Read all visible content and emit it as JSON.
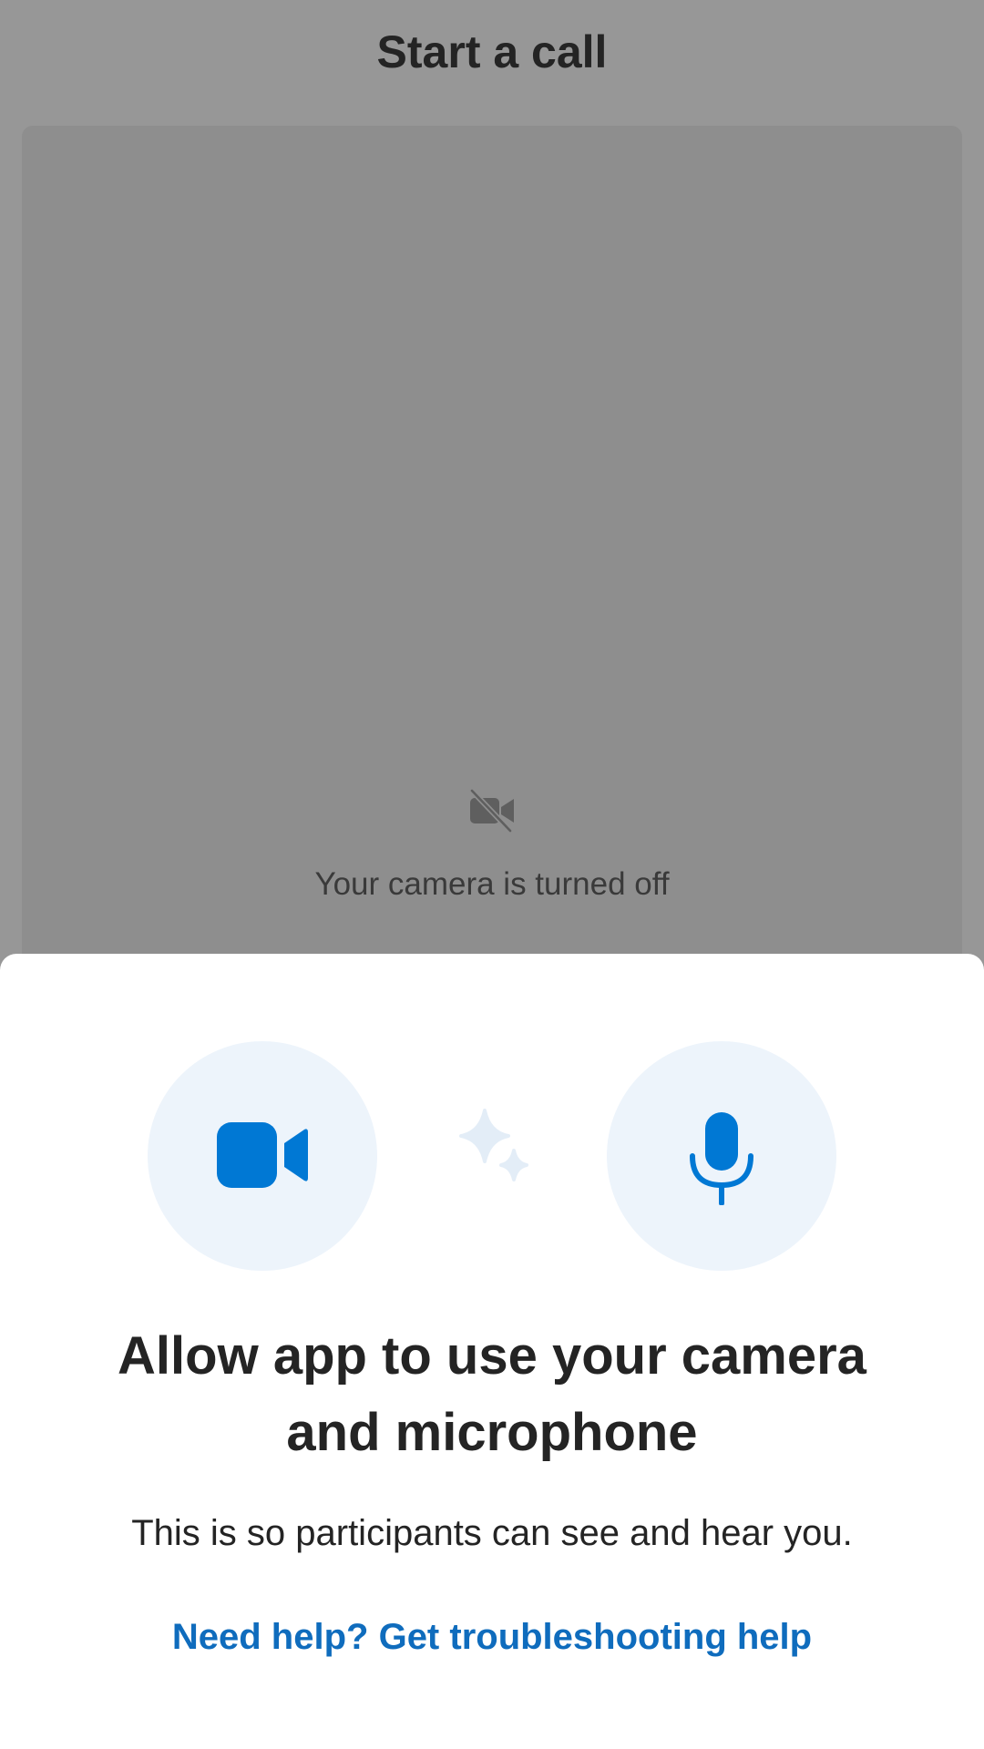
{
  "header": {
    "title": "Start a call"
  },
  "preview": {
    "camera_off_icon": "video-off-icon",
    "camera_off_text": "Your camera is turned off"
  },
  "permission_sheet": {
    "camera_icon": "video-camera-icon",
    "mic_icon": "microphone-icon",
    "sparkle_icon": "sparkle-icon",
    "heading": "Allow app to use your camera and microphone",
    "body": "This is so participants can see and hear you.",
    "help_link": "Need help? Get troubleshooting help"
  },
  "colors": {
    "accent": "#0f6cbd",
    "icon_blue": "#0078d4",
    "circle_bg": "#edf4fb",
    "overlay": "#979797"
  }
}
